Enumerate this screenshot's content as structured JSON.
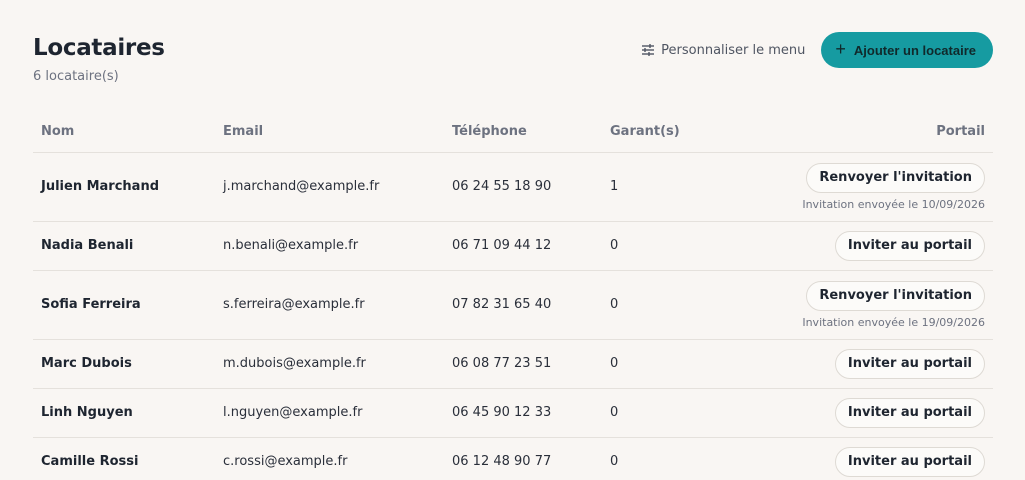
{
  "header": {
    "title": "Locataires",
    "subtitle": "6 locataire(s)",
    "customize_label": "Personnaliser le menu",
    "add_label": "Ajouter un locataire"
  },
  "table": {
    "columns": [
      "Nom",
      "Email",
      "Téléphone",
      "Garant(s)",
      "Portail"
    ],
    "rows": [
      {
        "name": "Julien Marchand",
        "email": "j.marchand@example.fr",
        "phone": "06 24 55 18 90",
        "garants": "1",
        "action": "Renvoyer l'invitation",
        "note": "Invitation envoyée le 10/09/2026"
      },
      {
        "name": "Nadia Benali",
        "email": "n.benali@example.fr",
        "phone": "06 71 09 44 12",
        "garants": "0",
        "action": "Inviter au portail"
      },
      {
        "name": "Sofia Ferreira",
        "email": "s.ferreira@example.fr",
        "phone": "07 82 31 65 40",
        "garants": "0",
        "action": "Renvoyer l'invitation",
        "note": "Invitation envoyée le 19/09/2026"
      },
      {
        "name": "Marc Dubois",
        "email": "m.dubois@example.fr",
        "phone": "06 08 77 23 51",
        "garants": "0",
        "action": "Inviter au portail"
      },
      {
        "name": "Linh Nguyen",
        "email": "l.nguyen@example.fr",
        "phone": "06 45 90 12 33",
        "garants": "0",
        "action": "Inviter au portail"
      },
      {
        "name": "Camille Rossi",
        "email": "c.rossi@example.fr",
        "phone": "06 12 48 90 77",
        "garants": "0",
        "action": "Inviter au portail"
      }
    ]
  },
  "colors": {
    "accent": "#169ba1",
    "background": "#f9f6f3"
  },
  "icons": {
    "customize": "sliders-icon",
    "add": "plus-icon"
  }
}
